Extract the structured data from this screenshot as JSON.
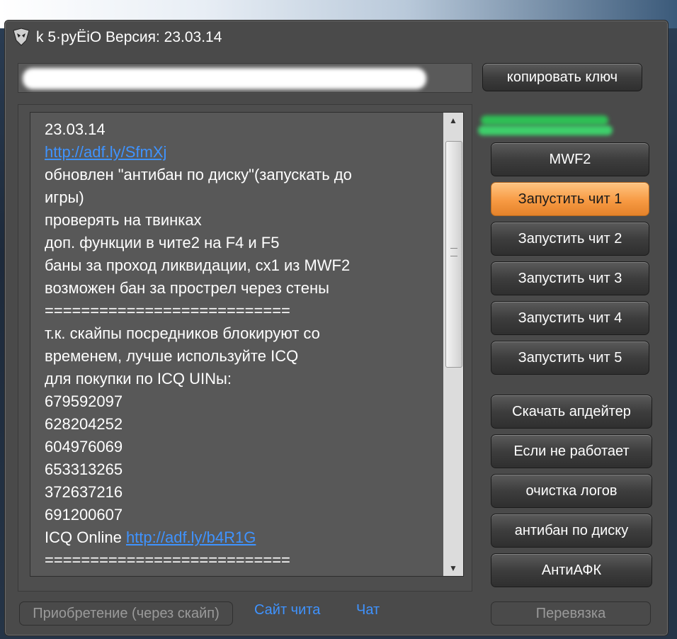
{
  "window": {
    "title": "k 5·pyËiO Версия: 23.03.14"
  },
  "header": {
    "copy_key_label": "копировать ключ"
  },
  "log": {
    "lines": [
      {
        "text": "23.03.14",
        "link": false
      },
      {
        "text": "http://adf.ly/SfmXj",
        "link": true
      },
      {
        "text": "обновлен \"антибан по диску\"(запускать до",
        "link": false
      },
      {
        "text": "игры)",
        "link": false
      },
      {
        "text": "проверять на твинках",
        "link": false
      },
      {
        "text": "доп. функции в чите2 на F4 и F5",
        "link": false
      },
      {
        "text": "баны за проход ликвидации, сх1 из MWF2",
        "link": false
      },
      {
        "text": "возможен бан за прострел через стены",
        "link": false
      },
      {
        "text": "===========================",
        "link": false
      },
      {
        "text": "т.к. скайпы посредников блокируют со",
        "link": false
      },
      {
        "text": "временем, лучше используйте ICQ",
        "link": false
      },
      {
        "text": "для покупки по ICQ UINы:",
        "link": false
      },
      {
        "text": "679592097",
        "link": false
      },
      {
        "text": "628204252",
        "link": false
      },
      {
        "text": "604976069",
        "link": false
      },
      {
        "text": "653313265",
        "link": false
      },
      {
        "text": "372637216",
        "link": false
      },
      {
        "text": "691200607",
        "link": false
      }
    ],
    "icq_online_prefix": "ICQ Online ",
    "icq_online_link": "http://adf.ly/b4R1G",
    "separator_bottom": "==========================="
  },
  "buttons": {
    "game": "MWF2",
    "cheat1": "Запустить чит 1",
    "cheat2": "Запустить чит 2",
    "cheat3": "Запустить чит 3",
    "cheat4": "Запустить чит 4",
    "cheat5": "Запустить чит 5",
    "download_updater": "Скачать апдейтер",
    "if_not_working": "Если не работает",
    "clear_logs": "очистка логов",
    "antiban_disk": "антибан по диску",
    "anti_afk": "АнтиАФК",
    "rebind": "Перевязка"
  },
  "footer": {
    "purchase": "Приобретение (через скайп)",
    "site": "Сайт чита",
    "chat": "Чат"
  },
  "colors": {
    "accent_active": "#f79a43",
    "link": "#3f93ff"
  }
}
